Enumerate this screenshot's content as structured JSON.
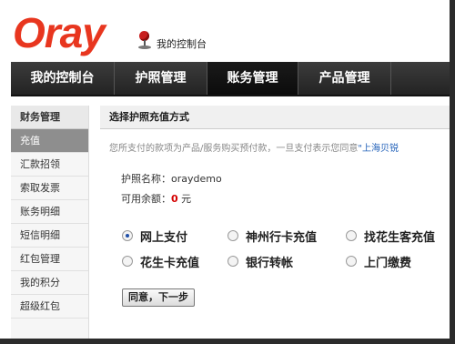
{
  "header": {
    "logo_text": "Oray",
    "console_label": "我的控制台"
  },
  "nav": {
    "items": [
      {
        "label": "我的控制台"
      },
      {
        "label": "护照管理"
      },
      {
        "label": "账务管理"
      },
      {
        "label": "产品管理"
      }
    ],
    "active_index": 2
  },
  "sidebar": {
    "header": "财务管理",
    "items": [
      {
        "label": "充值"
      },
      {
        "label": "汇款招领"
      },
      {
        "label": "索取发票"
      },
      {
        "label": "账务明细"
      },
      {
        "label": "短信明细"
      },
      {
        "label": "红包管理"
      },
      {
        "label": "我的积分"
      },
      {
        "label": "超级红包"
      }
    ],
    "active_index": 0
  },
  "main": {
    "title": "选择护照充值方式",
    "notice_text": "您所支付的款项为产品/服务购买预付款，一旦支付表示您同意",
    "notice_link": "\"上海贝锐",
    "passport_label": "护照名称：",
    "passport_value": "oraydemo",
    "balance_label": "可用余额：",
    "balance_value": "0",
    "balance_unit": "元",
    "payment_options": [
      {
        "label": "网上支付",
        "checked": true
      },
      {
        "label": "神州行卡充值",
        "checked": false
      },
      {
        "label": "找花生客充值",
        "checked": false
      },
      {
        "label": "花生卡充值",
        "checked": false
      },
      {
        "label": "银行转帐",
        "checked": false
      },
      {
        "label": "上门缴费",
        "checked": false
      }
    ],
    "next_button": "同意，下一步"
  },
  "colors": {
    "brand": "#e8361f",
    "nav_bg": "#2a2a2a",
    "sidebar_active": "#8e8e8e",
    "link": "#1f5fb8",
    "balance": "#d40000"
  }
}
